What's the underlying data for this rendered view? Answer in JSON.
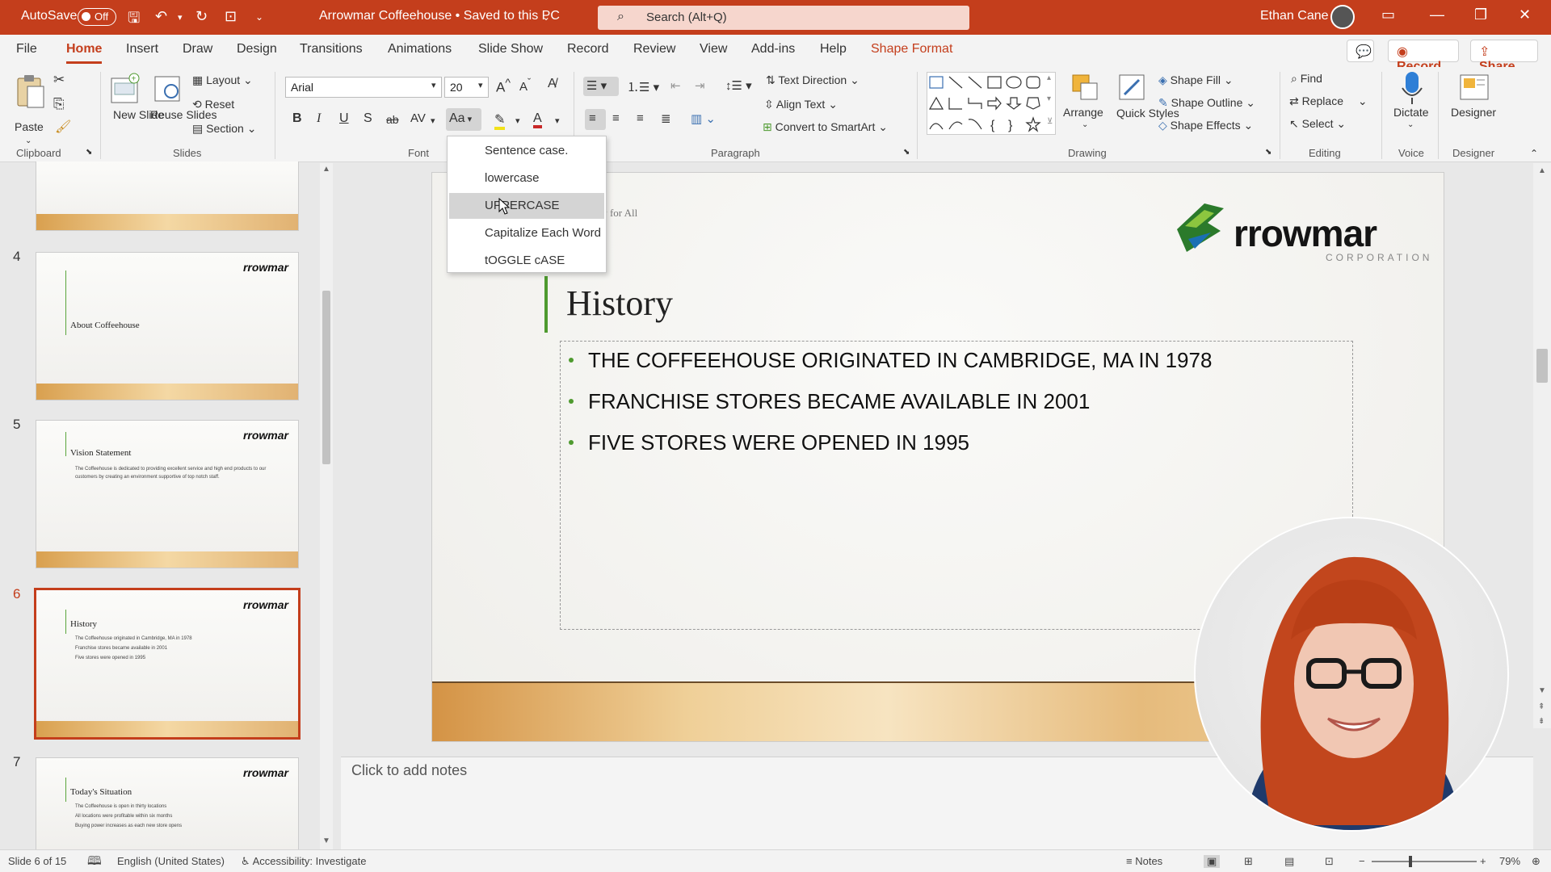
{
  "titlebar": {
    "autosave_label": "AutoSave",
    "autosave_state": "Off",
    "doc_title": "Arrowmar Coffeehouse • Saved to this PC",
    "search_placeholder": "Search (Alt+Q)",
    "user_name": "Ethan Cane"
  },
  "menu": {
    "tabs": [
      "File",
      "Home",
      "Insert",
      "Draw",
      "Design",
      "Transitions",
      "Animations",
      "Slide Show",
      "Record",
      "Review",
      "View",
      "Add-ins",
      "Help",
      "Shape Format"
    ],
    "active": "Home",
    "record_button": "Record",
    "share_button": "Share"
  },
  "ribbon": {
    "clipboard": {
      "paste": "Paste",
      "label": "Clipboard"
    },
    "slides": {
      "new_slide": "New Slide",
      "reuse_slides": "Reuse Slides",
      "layout": "Layout",
      "reset": "Reset",
      "section": "Section",
      "label": "Slides"
    },
    "font": {
      "font_name": "Arial",
      "font_size": "20",
      "bold": "B",
      "italic": "I",
      "underline": "U",
      "shadow": "S",
      "strike": "ab",
      "spacing": "AV",
      "change_case": "Aa",
      "label": "Font"
    },
    "paragraph": {
      "text_direction": "Text Direction",
      "align_text": "Align Text",
      "convert_smartart": "Convert to SmartArt",
      "label": "Paragraph"
    },
    "drawing": {
      "arrange": "Arrange",
      "quick_styles": "Quick Styles",
      "shape_fill": "Shape Fill",
      "shape_outline": "Shape Outline",
      "shape_effects": "Shape Effects",
      "label": "Drawing"
    },
    "editing": {
      "find": "Find",
      "replace": "Replace",
      "select": "Select",
      "label": "Editing"
    },
    "voice": {
      "dictate": "Dictate",
      "label": "Voice"
    },
    "designer": {
      "designer": "Designer",
      "label": "Designer"
    }
  },
  "case_menu": {
    "items": [
      "Sentence case.",
      "lowercase",
      "UPPERCASE",
      "Capitalize Each Word",
      "tOGGLE cASE"
    ],
    "highlighted": "UPPERCASE"
  },
  "slides_panel": {
    "thumbs": [
      {
        "num": "4",
        "title": "About Coffeehouse",
        "bullets": []
      },
      {
        "num": "5",
        "title": "Vision Statement",
        "bullets": [
          "The Coffeehouse is dedicated to providing excellent service and high end products to our customers by creating an environment supportive of top notch staff."
        ]
      },
      {
        "num": "6",
        "title": "History",
        "bullets": [
          "The Coffeehouse originated in Cambridge, MA in 1978",
          "Franchise stores became available in 2001",
          "Five stores were opened in 1995"
        ]
      },
      {
        "num": "7",
        "title": "Today's Situation",
        "bullets": [
          "The Coffeehouse is open in thirty locations",
          "All locations were profitable within six months",
          "Buying power increases as each new store opens"
        ]
      }
    ],
    "thumb_logo": "rrowmar",
    "selected": "6"
  },
  "slide": {
    "subtitle": "unity for All",
    "title": "History",
    "logo_text": "rrowmar",
    "logo_sub": "CORPORATION",
    "bullets": [
      "THE COFFEEHOUSE ORIGINATED IN CAMBRIDGE, MA IN 1978",
      "FRANCHISE STORES BECAME AVAILABLE IN 2001",
      "FIVE STORES WERE OPENED IN 1995"
    ]
  },
  "notes": {
    "placeholder": "Click to add notes"
  },
  "statusbar": {
    "slide_info": "Slide 6 of 15",
    "language": "English (United States)",
    "accessibility": "Accessibility: Investigate",
    "notes_button": "Notes",
    "zoom": "79%"
  },
  "colors": {
    "accent": "#c43e1c",
    "green": "#4e9a2f"
  }
}
